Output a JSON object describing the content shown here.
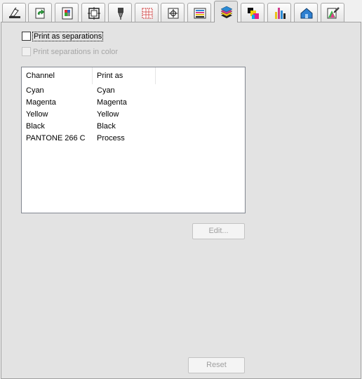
{
  "tabs": [
    {
      "icon": "printer-setup-icon"
    },
    {
      "icon": "page-rotate-icon"
    },
    {
      "icon": "color-page-icon"
    },
    {
      "icon": "frame-fit-icon"
    },
    {
      "icon": "pen-tip-icon"
    },
    {
      "icon": "grid-marks-icon"
    },
    {
      "icon": "registration-icon"
    },
    {
      "icon": "color-bars-icon"
    },
    {
      "icon": "separations-stack-icon",
      "active": true
    },
    {
      "icon": "cmyk-squares-icon"
    },
    {
      "icon": "color-columns-icon"
    },
    {
      "icon": "blue-house-icon"
    },
    {
      "icon": "eyedropper-spectrum-icon"
    }
  ],
  "options": {
    "print_as_separations": "Print as separations",
    "print_separations_in_color": "Print separations in color"
  },
  "table": {
    "columns": [
      "Channel",
      "Print as"
    ],
    "rows": [
      {
        "channel": "Cyan",
        "print_as": "Cyan"
      },
      {
        "channel": "Magenta",
        "print_as": "Magenta"
      },
      {
        "channel": "Yellow",
        "print_as": "Yellow"
      },
      {
        "channel": "Black",
        "print_as": "Black"
      },
      {
        "channel": "PANTONE 266 C",
        "print_as": "Process"
      }
    ]
  },
  "buttons": {
    "edit": "Edit...",
    "reset": "Reset"
  }
}
